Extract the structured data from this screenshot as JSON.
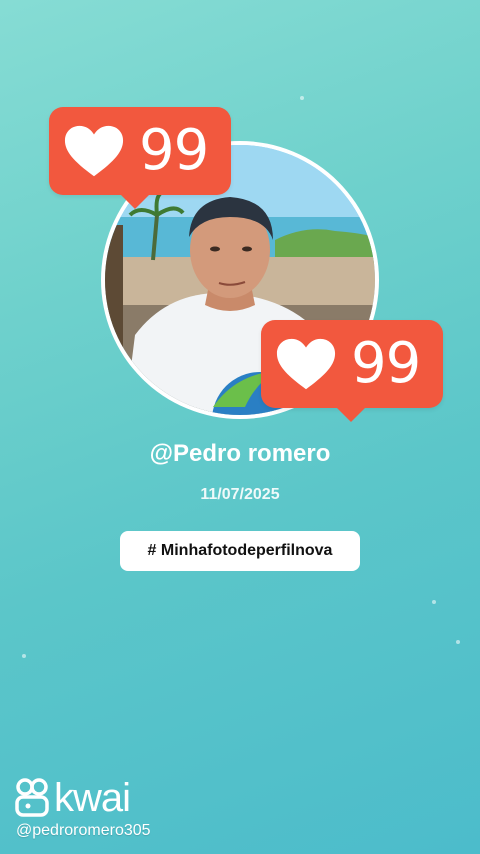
{
  "profile": {
    "username": "@Pedro romero",
    "date": "11/07/2025",
    "hashtag": "# Minhafotodeperfilnova"
  },
  "likes": [
    {
      "icon": "heart-icon",
      "count": "99"
    },
    {
      "icon": "heart-icon",
      "count": "99"
    }
  ],
  "watermark": {
    "brand": "kwai",
    "handle": "@pedroromero305"
  },
  "colors": {
    "background_top": "#86dcd4",
    "background_bottom": "#4cbccb",
    "badge": "#f2583e",
    "pill": "#ffffff"
  }
}
